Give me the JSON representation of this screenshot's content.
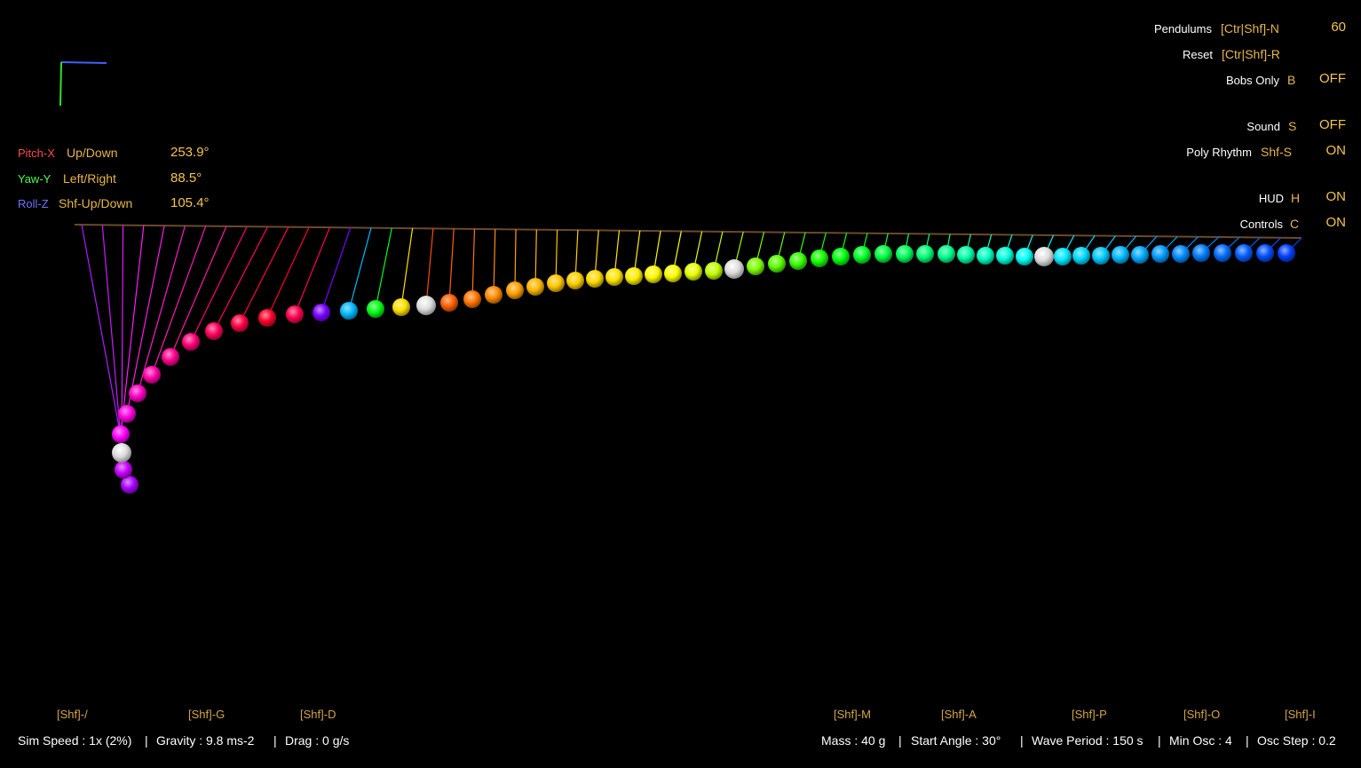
{
  "axes": [
    {
      "name": "Pitch-X",
      "action": "Up/Down",
      "value": "253.9°",
      "color": "#ff4a4a"
    },
    {
      "name": "Yaw-Y",
      "action": "Left/Right",
      "value": "88.5°",
      "color": "#4aff4a"
    },
    {
      "name": "Roll-Z",
      "action": "Shf-Up/Down",
      "value": "105.4°",
      "color": "#7070ff"
    }
  ],
  "controls": {
    "pendulums": {
      "label": "Pendulums",
      "key": "[Ctr|Shf]-N",
      "value": "60"
    },
    "reset": {
      "label": "Reset",
      "key": "[Ctr|Shf]-R"
    },
    "bobs_only": {
      "label": "Bobs Only",
      "key": "B",
      "value": "OFF"
    },
    "sound": {
      "label": "Sound",
      "key": "S",
      "value": "OFF"
    },
    "poly_rhythm": {
      "label": "Poly Rhythm",
      "key": "Shf-S",
      "value": "ON"
    },
    "hud": {
      "label": "HUD",
      "key": "H",
      "value": "ON"
    },
    "controls": {
      "label": "Controls",
      "key": "C",
      "value": "ON"
    }
  },
  "hotkeys": {
    "speed": "[Shf]-/",
    "gravity": "[Shf]-G",
    "drag": "[Shf]-D",
    "mass": "[Shf]-M",
    "angle": "[Shf]-A",
    "period": "[Shf]-P",
    "min_osc": "[Shf]-O",
    "osc_step": "[Shf]-I"
  },
  "status": {
    "sim_speed": "Sim Speed : 1x (2%)",
    "gravity": "Gravity : 9.8 ms-2",
    "drag": "Drag : 0 g/s",
    "mass": "Mass : 40 g",
    "start_angle": "Start Angle : 30°",
    "wave_period": "Wave Period : 150 s",
    "min_osc": "Min Osc : 4",
    "osc_step": "Osc Step : 0.2",
    "separator": "|"
  },
  "colors": {
    "axis_x": "#4060ff",
    "axis_y": "#30e030",
    "bar": "#6a4a2a"
  }
}
